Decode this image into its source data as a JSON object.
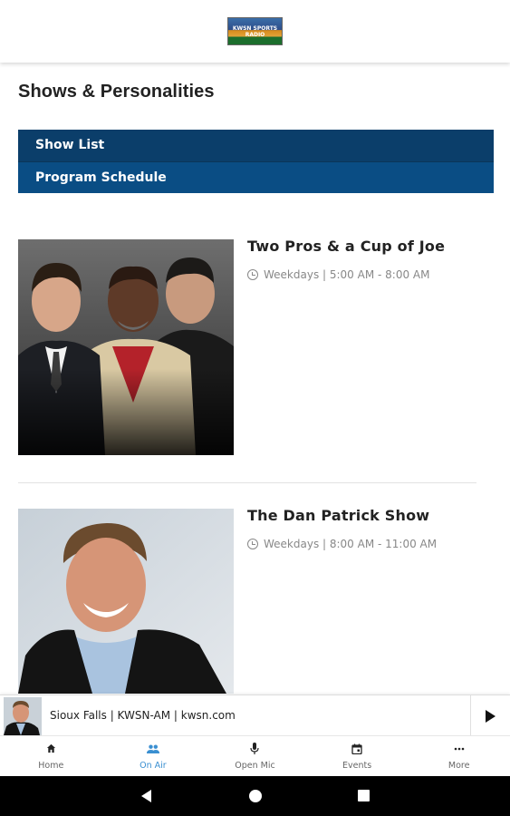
{
  "header": {
    "logo_text": "KWSN SPORTS RADIO"
  },
  "page_title": "Shows & Personalities",
  "subnav": {
    "items": [
      {
        "label": "Show List"
      },
      {
        "label": "Program Schedule"
      }
    ]
  },
  "shows": [
    {
      "title": "Two Pros & a Cup of Joe",
      "schedule": "Weekdays | 5:00 AM - 8:00 AM"
    },
    {
      "title": "The Dan Patrick Show",
      "schedule": "Weekdays | 8:00 AM - 11:00 AM"
    }
  ],
  "player": {
    "station_text": "Sioux Falls | KWSN-AM | kwsn.com",
    "play_icon": "play-icon"
  },
  "tabs": [
    {
      "label": "Home",
      "icon": "home-icon",
      "active": false
    },
    {
      "label": "On Air",
      "icon": "people-icon",
      "active": true
    },
    {
      "label": "Open Mic",
      "icon": "microphone-icon",
      "active": false
    },
    {
      "label": "Events",
      "icon": "calendar-icon",
      "active": false
    },
    {
      "label": "More",
      "icon": "more-icon",
      "active": false
    }
  ],
  "colors": {
    "subnav_bg": "#0a4a7e",
    "active_tab": "#3a8fd1",
    "system_bar": "#000000"
  }
}
